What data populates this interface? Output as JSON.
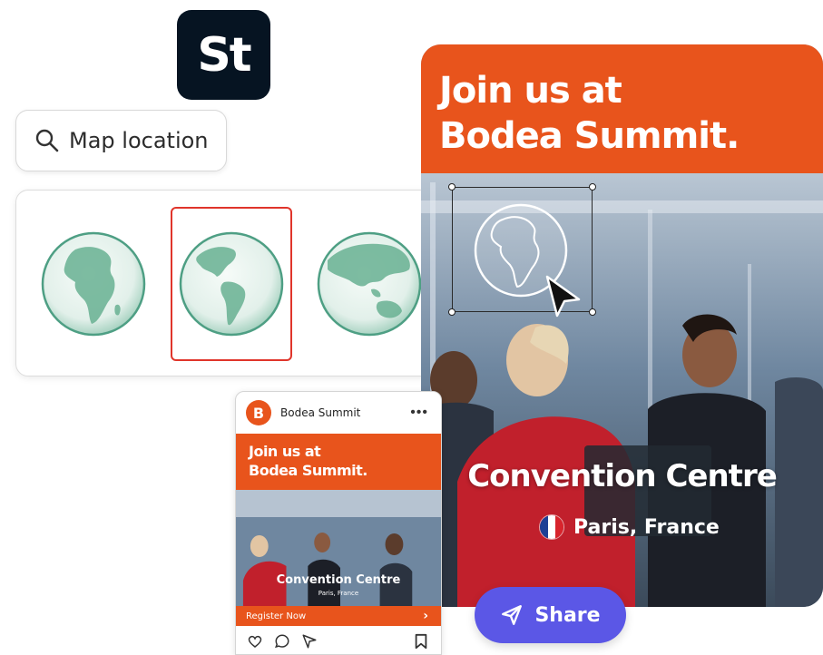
{
  "logo": {
    "text": "St",
    "bg": "#061422"
  },
  "search": {
    "icon": "search-icon",
    "label": "Map location"
  },
  "globes": {
    "items": [
      "globe-africa-europe",
      "globe-americas",
      "globe-asia-australia"
    ],
    "selected_index": 1,
    "selection_color": "#e0352b"
  },
  "banner": {
    "title_line1": "Join us at",
    "title_line2": "Bodea Summit.",
    "subtitle": "Convention Centre",
    "location": "Paris, France",
    "accent": "#e8541c"
  },
  "share": {
    "label": "Share",
    "icon": "send-icon",
    "color": "#5b57e6"
  },
  "post": {
    "account_initial": "B",
    "account_name": "Bodea Summit",
    "more_icon": "more-icon",
    "title_line1": "Join us at",
    "title_line2": "Bodea Summit.",
    "subtitle": "Convention Centre",
    "location": "Paris, France",
    "cta": "Register Now",
    "actions": [
      "heart-icon",
      "comment-icon",
      "send-icon",
      "bookmark-icon"
    ]
  }
}
